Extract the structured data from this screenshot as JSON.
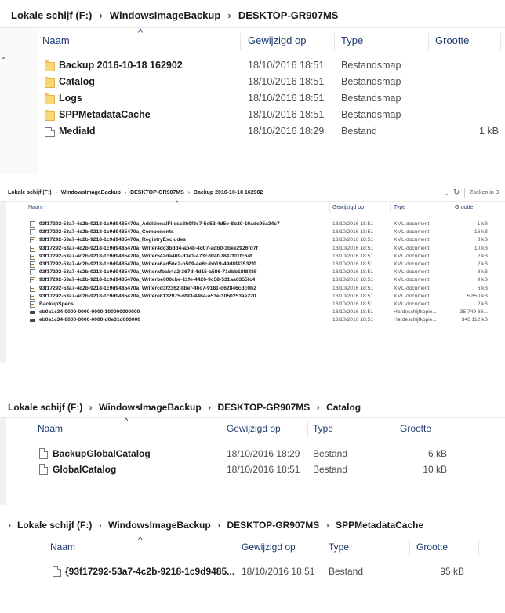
{
  "separator": "›",
  "panel1": {
    "crumbs": [
      "Lokale schijf (F:)",
      "WindowsImageBackup",
      "DESKTOP-GR907MS"
    ],
    "headers": {
      "name": "Naam",
      "modified": "Gewijzigd op",
      "type": "Type",
      "size": "Grootte"
    },
    "rows": [
      {
        "name": "Backup 2016-10-18 162902",
        "modified": "18/10/2016 18:51",
        "type": "Bestandsmap",
        "size": "",
        "icon": "folder-icon"
      },
      {
        "name": "Catalog",
        "modified": "18/10/2016 18:51",
        "type": "Bestandsmap",
        "size": "",
        "icon": "folder-icon"
      },
      {
        "name": "Logs",
        "modified": "18/10/2016 18:51",
        "type": "Bestandsmap",
        "size": "",
        "icon": "folder-icon"
      },
      {
        "name": "SPPMetadataCache",
        "modified": "18/10/2016 18:51",
        "type": "Bestandsmap",
        "size": "",
        "icon": "folder-icon"
      },
      {
        "name": "MediaId",
        "modified": "18/10/2016 18:29",
        "type": "Bestand",
        "size": "1 kB",
        "icon": "file-icon"
      }
    ]
  },
  "panel2": {
    "crumbs": [
      "Lokale schijf (F:)",
      "WindowsImageBackup",
      "DESKTOP-GR907MS",
      "Backup 2016-10-18 162902"
    ],
    "search_placeholder": "Zoeken in B",
    "chevron": "⌄",
    "refresh": "↻",
    "headers": {
      "name": "Naam",
      "modified": "Gewijzigd op",
      "type": "Type",
      "size": "Grootte"
    },
    "rows": [
      {
        "name": "93f17292-53a7-4c2b-9218-1c9d9485470a_AdditionalFilesc3b9f3c7-5e52-4d5e-8b20-19adc95a34c7",
        "modified": "18/10/2016 18:51",
        "type": "XML-document",
        "size": "1 kB",
        "icon": "xml-icon"
      },
      {
        "name": "93f17292-53a7-4c2b-9218-1c9d9485470a_Components",
        "modified": "18/10/2016 18:51",
        "type": "XML-document",
        "size": "16 kB",
        "icon": "xml-icon"
      },
      {
        "name": "93f17292-53a7-4c2b-9218-1c9d9485470a_RegistryExcludes",
        "modified": "18/10/2016 18:51",
        "type": "XML-document",
        "size": "8 kB",
        "icon": "xml-icon"
      },
      {
        "name": "93f17292-53a7-4c2b-9218-1c9d9485470a_Writer4dc3bdd4-ab48-4d07-adb0-3bee2926fd7f",
        "modified": "18/10/2016 18:51",
        "type": "XML-document",
        "size": "10 kB",
        "icon": "xml-icon"
      },
      {
        "name": "93f17292-53a7-4c2b-9218-1c9d9485470a_Writer542da469-d3e1-473c-9f4f-7847f01fc64f",
        "modified": "18/10/2016 18:51",
        "type": "XML-document",
        "size": "2 kB",
        "icon": "xml-icon"
      },
      {
        "name": "93f17292-53a7-4c2b-9218-1c9d9485470a_Writera6ad56c2-b509-4e6c-bb19-49d8f43532f0",
        "modified": "18/10/2016 18:51",
        "type": "XML-document",
        "size": "2 kB",
        "icon": "xml-icon"
      },
      {
        "name": "93f17292-53a7-4c2b-9218-1c9d9485470a_Writerafbab4a2-367d-4d15-a586-71dbb18f8485",
        "modified": "18/10/2016 18:51",
        "type": "XML-document",
        "size": "3 kB",
        "icon": "xml-icon"
      },
      {
        "name": "93f17292-53a7-4c2b-9218-1c9d9485470a_Writerbe000cbe-11fe-4426-9c58-531aa6355fc4",
        "modified": "18/10/2016 18:51",
        "type": "XML-document",
        "size": "9 kB",
        "icon": "xml-icon"
      },
      {
        "name": "93f17292-53a7-4c2b-9218-1c9d9485470a_Writercd3f2362-8bef-46c7-9181-d62846cdc0b2",
        "modified": "18/10/2016 18:51",
        "type": "XML-document",
        "size": "6 kB",
        "icon": "xml-icon"
      },
      {
        "name": "93f17292-53a7-4c2b-9218-1c9d9485470a_Writere8132975-6f93-4464-a53e-1050253ae220",
        "modified": "18/10/2016 18:51",
        "type": "XML-document",
        "size": "5 850 kB",
        "icon": "xml-icon"
      },
      {
        "name": "BackupSpecs",
        "modified": "18/10/2016 18:51",
        "type": "XML-document",
        "size": "2 kB",
        "icon": "xml-icon"
      },
      {
        "name": "eb0a1c34-0000-0000-0000-100000000000",
        "modified": "18/10/2016 18:51",
        "type": "Hardeschijfkopie...",
        "size": "35 749 88...",
        "icon": "vhd-icon"
      },
      {
        "name": "eb0a1c34-0000-0000-0000-d0e31d000000",
        "modified": "18/10/2016 18:51",
        "type": "Hardeschijfkopie...",
        "size": "346 112 kB",
        "icon": "vhd-icon"
      }
    ]
  },
  "panel3": {
    "crumbs": [
      "Lokale schijf (F:)",
      "WindowsImageBackup",
      "DESKTOP-GR907MS",
      "Catalog"
    ],
    "headers": {
      "name": "Naam",
      "modified": "Gewijzigd op",
      "type": "Type",
      "size": "Grootte"
    },
    "rows": [
      {
        "name": "BackupGlobalCatalog",
        "modified": "18/10/2016 18:29",
        "type": "Bestand",
        "size": "6 kB",
        "icon": "file-icon"
      },
      {
        "name": "GlobalCatalog",
        "modified": "18/10/2016 18:51",
        "type": "Bestand",
        "size": "10 kB",
        "icon": "file-icon"
      }
    ]
  },
  "panel4": {
    "crumbs": [
      "Lokale schijf (F:)",
      "WindowsImageBackup",
      "DESKTOP-GR907MS",
      "SPPMetadataCache"
    ],
    "headers": {
      "name": "Naam",
      "modified": "Gewijzigd op",
      "type": "Type",
      "size": "Grootte"
    },
    "rows": [
      {
        "name": "{93f17292-53a7-4c2b-9218-1c9d9485...",
        "modified": "18/10/2016 18:51",
        "type": "Bestand",
        "size": "95 kB",
        "icon": "file-icon"
      }
    ]
  }
}
